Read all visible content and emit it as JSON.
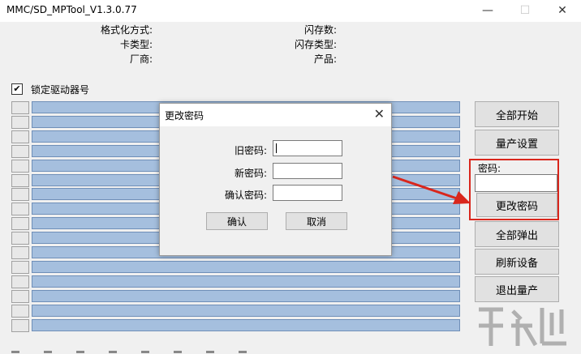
{
  "window": {
    "title": "MMC/SD_MPTool_V1.3.0.77",
    "controls": {
      "minimize": "—",
      "maximize": "☐",
      "close": "✕"
    }
  },
  "info": {
    "left": [
      "格式化方式:",
      "卡类型:",
      "厂商:"
    ],
    "right": [
      "闪存数:",
      "闪存类型:",
      "产品:"
    ]
  },
  "lock_checkbox": {
    "checked": true,
    "mark": "✔",
    "label": "锁定驱动器号"
  },
  "side_buttons": {
    "start_all": "全部开始",
    "production_settings": "量产设置",
    "password_label": "密码:",
    "change_password": "更改密码",
    "eject_all": "全部弹出",
    "refresh_devices": "刷新设备",
    "exit_production": "退出量产"
  },
  "dialog": {
    "title": "更改密码",
    "close": "✕",
    "old_password_label": "旧密码:",
    "new_password_label": "新密码:",
    "confirm_password_label": "确认密码:",
    "ok": "确认",
    "cancel": "取消"
  },
  "colors": {
    "slot_bar": "#a5bfde",
    "highlight": "#d9261c",
    "arrow": "#d9261c"
  }
}
